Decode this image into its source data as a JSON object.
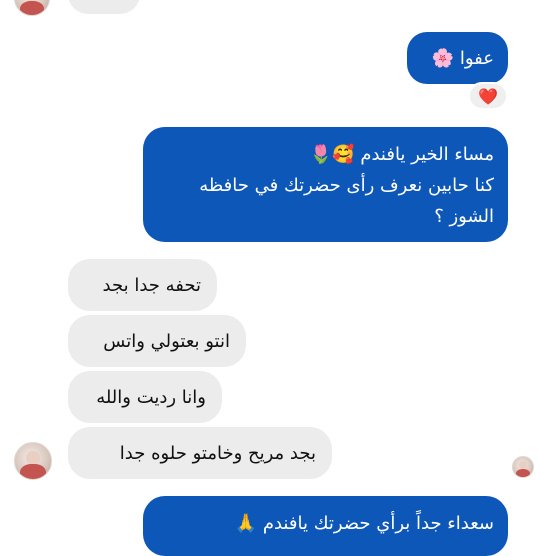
{
  "messages": {
    "afwan": {
      "text": "عفوا",
      "emoji": "🌸"
    },
    "reaction": {
      "emoji": "❤️"
    },
    "greeting": {
      "line1": "مساء الخير يافندم",
      "line1_emoji": "🥰🌷",
      "line2": "كنا حابين نعرف رأى حضرتك في حافظه",
      "line3": "الشوز ؟"
    },
    "reply1": "تحفه جدا بجد",
    "reply2": "انتو بعتولي واتس",
    "reply3": "وانا رديت والله",
    "reply4": "بجد مريح وخامتو حلوه جدا",
    "final": {
      "text": "سعداء جداً برأي حضرتك يافندم",
      "emoji": "🙏"
    }
  },
  "colors": {
    "outgoing_bubble": "#0d57b8",
    "incoming_bubble": "#ececec",
    "reaction_heart": "#e0245e"
  }
}
